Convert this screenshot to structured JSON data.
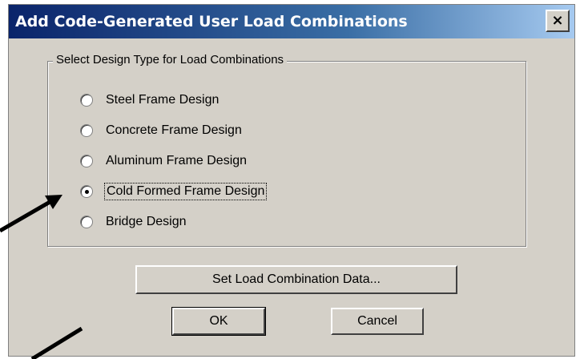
{
  "window": {
    "title": "Add Code-Generated User Load Combinations",
    "close_glyph": "×"
  },
  "group": {
    "legend": "Select Design Type for Load Combinations",
    "options": [
      {
        "label": "Steel Frame Design",
        "selected": false
      },
      {
        "label": "Concrete Frame Design",
        "selected": false
      },
      {
        "label": "Aluminum Frame Design",
        "selected": false
      },
      {
        "label": "Cold Formed Frame Design",
        "selected": true
      },
      {
        "label": "Bridge Design",
        "selected": false
      }
    ]
  },
  "buttons": {
    "set_data": "Set Load Combination Data...",
    "ok": "OK",
    "cancel": "Cancel"
  },
  "colors": {
    "dialog_bg": "#d4d0c8",
    "title_gradient_start": "#0a246a",
    "title_gradient_end": "#a6caf0",
    "annotation_arrow": "#000000"
  }
}
